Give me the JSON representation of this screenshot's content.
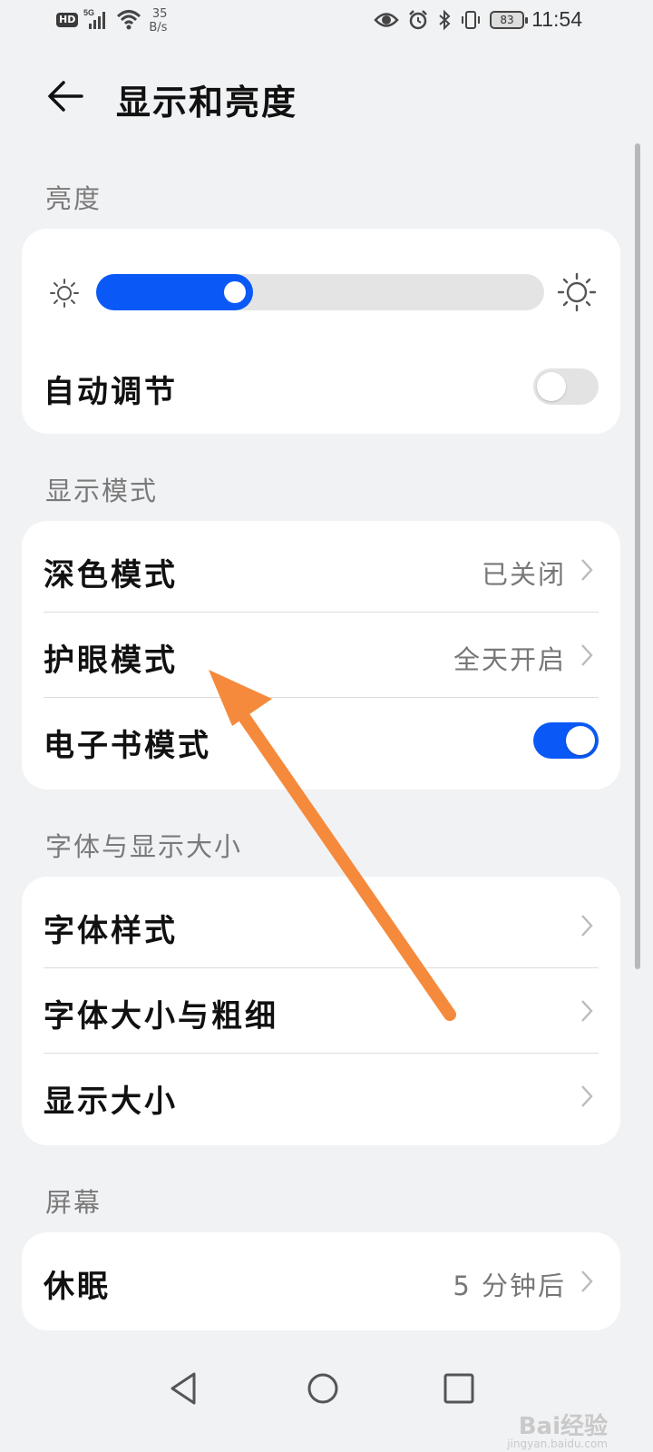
{
  "status_bar": {
    "hd": "HD",
    "signal": "5G",
    "speed_value": "35",
    "speed_unit": "B/s",
    "battery": "83",
    "time": "11:54"
  },
  "header": {
    "title": "显示和亮度"
  },
  "sections": {
    "brightness": {
      "title": "亮度",
      "brightness_level": 0.35,
      "auto_adjust_label": "自动调节",
      "auto_adjust_on": false
    },
    "display_mode": {
      "title": "显示模式",
      "dark_mode_label": "深色模式",
      "dark_mode_value": "已关闭",
      "eye_comfort_label": "护眼模式",
      "eye_comfort_value": "全天开启",
      "ebook_label": "电子书模式",
      "ebook_on": true
    },
    "font_display": {
      "title": "字体与显示大小",
      "font_style_label": "字体样式",
      "font_size_label": "字体大小与粗细",
      "display_size_label": "显示大小"
    },
    "screen": {
      "title": "屏幕",
      "sleep_label": "休眠",
      "sleep_value": "5 分钟后"
    }
  },
  "colors": {
    "accent": "#0a59f7",
    "annotation_arrow": "#f58a3c"
  },
  "watermark": {
    "brand": "Bai经验",
    "url": "jingyan.baidu.com"
  },
  "icons": [
    "back-arrow-icon",
    "sun-small-icon",
    "sun-large-icon",
    "chevron-right-icon",
    "nav-back-icon",
    "nav-home-icon",
    "nav-recents-icon"
  ]
}
